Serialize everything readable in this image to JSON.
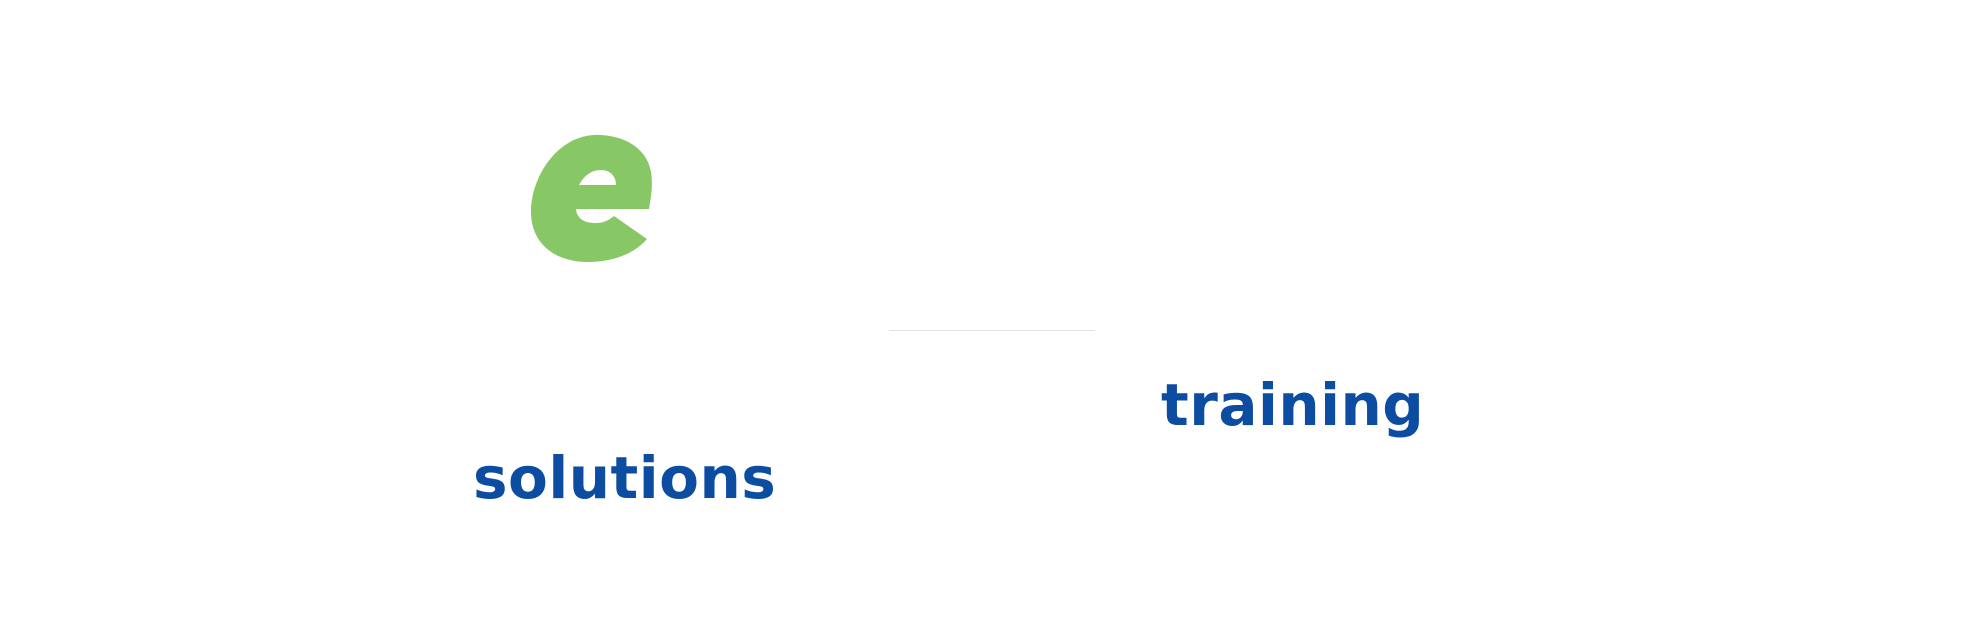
{
  "colors": {
    "brand_green": "#88c766",
    "brand_blue": "#0d4da1",
    "background": "#ffffff",
    "divider": "#dfe3e8"
  },
  "logo": {
    "icon": "green-e-logo-icon",
    "letter": "e"
  },
  "words": {
    "training": "training",
    "solutions": "solutions"
  }
}
